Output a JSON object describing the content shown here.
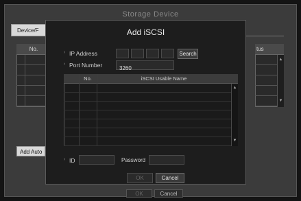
{
  "background": {
    "title": "Storage Device",
    "tab_label": "Device/F",
    "table_no_header": "No.",
    "status_header": "tus",
    "add_auto_label": "Add Auto",
    "ok_label": "OK",
    "cancel_label": "Cancel"
  },
  "modal": {
    "title": "Add iSCSI",
    "ip_address_label": "IP Address",
    "ip_octets": [
      "",
      "",
      "",
      ""
    ],
    "search_label": "Search",
    "port_label": "Port Number",
    "port_value": "3260",
    "table": {
      "columns": [
        "No.",
        "iSCSI Usable Name"
      ],
      "rows": [
        [
          "",
          ""
        ],
        [
          "",
          ""
        ],
        [
          "",
          ""
        ],
        [
          "",
          ""
        ],
        [
          "",
          ""
        ],
        [
          "",
          ""
        ],
        [
          "",
          ""
        ]
      ]
    },
    "id_label": "ID",
    "id_value": "",
    "password_label": "Password",
    "password_value": "",
    "ok_label": "OK",
    "cancel_label": "Cancel"
  },
  "icons": {
    "scroll_up": "▲",
    "scroll_down": "▼",
    "bullet": "›"
  }
}
